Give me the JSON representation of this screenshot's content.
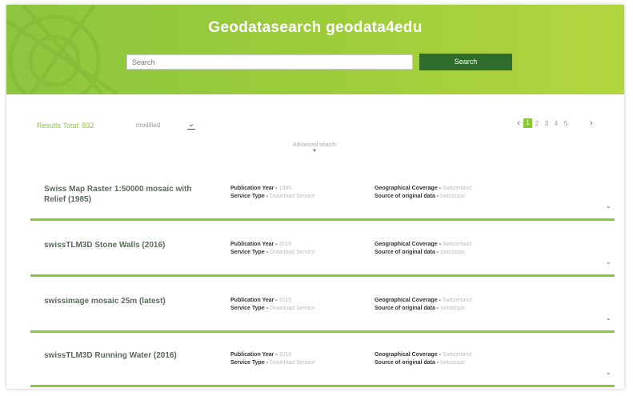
{
  "header": {
    "title": "Geodatasearch geodata4edu",
    "search_placeholder": "Search",
    "search_button": "Search"
  },
  "toolbar": {
    "results_total": "Results Total: 832",
    "sort_value": "modified",
    "advanced_search": "Advanced search"
  },
  "pagination": {
    "prev": "‹",
    "pages": [
      "1",
      "2",
      "3",
      "4",
      "5"
    ],
    "active_page": "1",
    "next": "›"
  },
  "labels": {
    "publication_year": "Publication Year -",
    "service_type": "Service Type -",
    "geographical_coverage": "Geographical Coverage -",
    "source_of_original_data": "Source of original data -"
  },
  "results": [
    {
      "title": "Swiss Map Raster 1:50000 mosaic with Relief (1985)",
      "publication_year": "1985",
      "service_type": "Download Service",
      "coverage": "Switzerland",
      "source": "swisstopo"
    },
    {
      "title": "swissTLM3D Stone Walls (2016)",
      "publication_year": "2016",
      "service_type": "Download Service",
      "coverage": "Switzerland",
      "source": "swisstopo"
    },
    {
      "title": "swissimage mosaic 25m (latest)",
      "publication_year": "2015",
      "service_type": "Download Service",
      "coverage": "Switzerland",
      "source": "swisstopo"
    },
    {
      "title": "swissTLM3D Running Water (2016)",
      "publication_year": "2016",
      "service_type": "Download Service",
      "coverage": "Switzerland",
      "source": "swisstopo"
    }
  ],
  "colors": {
    "accent_green": "#8cc63f",
    "dark_green": "#2f6b2a"
  }
}
